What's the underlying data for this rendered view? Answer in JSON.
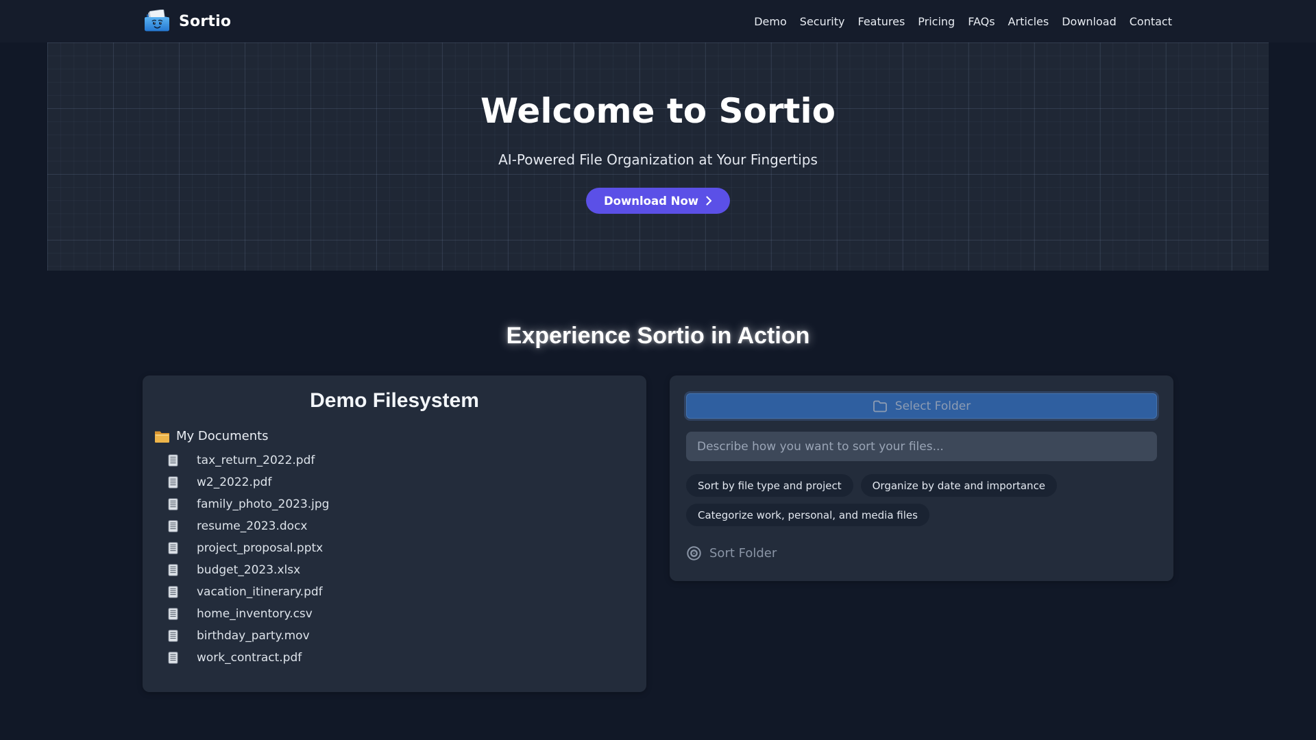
{
  "brand": {
    "name": "Sortio",
    "logo": "smiling-blue-folder"
  },
  "nav": {
    "items": [
      {
        "label": "Demo"
      },
      {
        "label": "Security"
      },
      {
        "label": "Features"
      },
      {
        "label": "Pricing"
      },
      {
        "label": "FAQs"
      },
      {
        "label": "Articles"
      },
      {
        "label": "Download"
      },
      {
        "label": "Contact"
      }
    ]
  },
  "hero": {
    "title": "Welcome to Sortio",
    "subtitle": "AI-Powered File Organization at Your Fingertips",
    "cta_label": "Download Now"
  },
  "demo_section": {
    "heading": "Experience Sortio in Action",
    "filesystem": {
      "title": "Demo Filesystem",
      "root_folder": "My Documents",
      "files": [
        "tax_return_2022.pdf",
        "w2_2022.pdf",
        "family_photo_2023.jpg",
        "resume_2023.docx",
        "project_proposal.pptx",
        "budget_2023.xlsx",
        "vacation_itinerary.pdf",
        "home_inventory.csv",
        "birthday_party.mov",
        "work_contract.pdf"
      ]
    },
    "sorter": {
      "select_folder_label": "Select Folder",
      "input_placeholder": "Describe how you want to sort your files...",
      "suggestions": [
        "Sort by file type and project",
        "Organize by date and importance",
        "Categorize work, personal, and media files"
      ],
      "sort_button_label": "Sort Folder"
    }
  },
  "colors": {
    "accent_indigo": "#5b50e7",
    "select_button_blue": "#2f5fa0",
    "navbar_bg": "#151c2b",
    "page_bg": "#111827",
    "card_bg": "#232c3b",
    "hero_grid_bg": "#1f2735",
    "folder_yellow": "#eeb54a"
  }
}
